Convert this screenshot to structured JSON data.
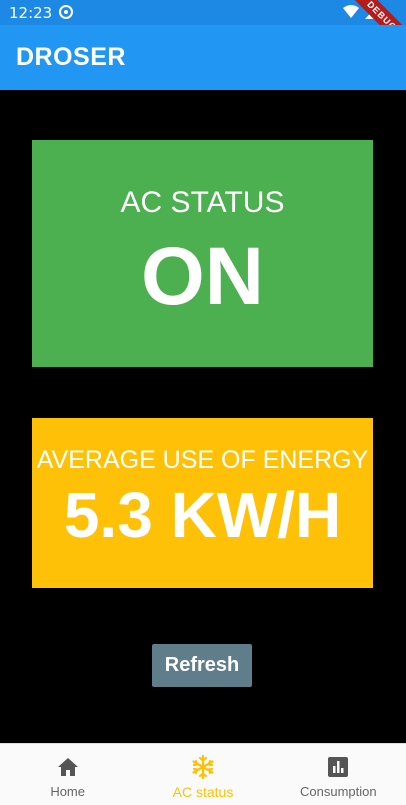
{
  "status_bar": {
    "time": "12:23",
    "debug_banner": "DEBUG"
  },
  "app_bar": {
    "title": "DROSER"
  },
  "ac_status_card": {
    "label": "AC STATUS",
    "value": "ON",
    "color": "#4caf50"
  },
  "energy_card": {
    "label": "AVERAGE USE OF ENERGY",
    "value": "5.3 KW/H",
    "color": "#ffc107"
  },
  "refresh_button": {
    "label": "Refresh"
  },
  "bottom_nav": {
    "items": [
      {
        "label": "Home",
        "icon": "home-icon"
      },
      {
        "label": "AC status",
        "icon": "snowflake-icon",
        "active": true
      },
      {
        "label": "Consumption",
        "icon": "bar-chart-icon"
      }
    ]
  },
  "colors": {
    "app_bar": "#2196f3",
    "accent": "#ffc107"
  }
}
